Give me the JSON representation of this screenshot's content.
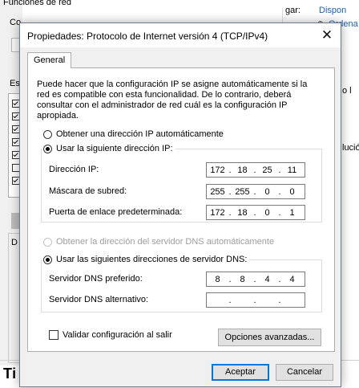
{
  "background": {
    "top_left_title": "Funciones de red",
    "left_label_1": "Co",
    "left_label_2": "Es",
    "right_label_1": "gar:",
    "right_label_2": "Dispon",
    "right_label_3": "Ordena",
    "right_label_4": "o l",
    "right_label_5": "lució",
    "bottom_heading": "Ti",
    "checkboxes": [
      true,
      true,
      true,
      true,
      true,
      false,
      true,
      false,
      true
    ]
  },
  "dialog": {
    "title": "Propiedades: Protocolo de Internet versión 4 (TCP/IPv4)",
    "close_glyph": "✕",
    "tab_general": "General",
    "description": "Puede hacer que la configuración IP se asigne automáticamente si la red es compatible con esta funcionalidad. De lo contrario, deberá consultar con el administrador de red cuál es la configuración IP apropiada.",
    "ip_auto_label": "Obtener una dirección IP automáticamente",
    "ip_manual_label": "Usar la siguiente dirección IP:",
    "ip_mode": "manual",
    "ip_address_label": "Dirección IP:",
    "ip_address": [
      "172",
      "18",
      "25",
      "11"
    ],
    "subnet_label": "Máscara de subred:",
    "subnet": [
      "255",
      "255",
      "0",
      "0"
    ],
    "gateway_label": "Puerta de enlace predeterminada:",
    "gateway": [
      "172",
      "18",
      "0",
      "1"
    ],
    "dns_auto_label": "Obtener la dirección del servidor DNS automáticamente",
    "dns_manual_label": "Usar las siguientes direcciones de servidor DNS:",
    "dns_mode": "manual",
    "dns_preferred_label": "Servidor DNS preferido:",
    "dns_preferred": [
      "8",
      "8",
      "4",
      "4"
    ],
    "dns_alternate_label": "Servidor DNS alternativo:",
    "dns_alternate": [
      "",
      "",
      "",
      ""
    ],
    "validate_label": "Validar configuración al salir",
    "validate_checked": false,
    "advanced_button": "Opciones avanzadas...",
    "accept_button": "Aceptar",
    "cancel_button": "Cancelar",
    "dot": "."
  }
}
